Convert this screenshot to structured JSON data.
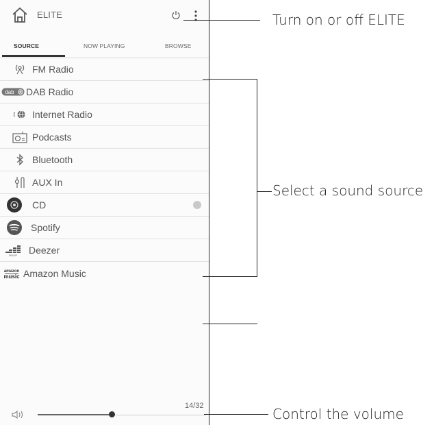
{
  "app": {
    "title": "ELITE"
  },
  "tabs": [
    {
      "label": "SOURCE",
      "active": true
    },
    {
      "label": "NOW PLAYING",
      "active": false
    },
    {
      "label": "BROWSE",
      "active": false
    }
  ],
  "sources": [
    {
      "label": "FM Radio",
      "icon": "fm-radio-icon"
    },
    {
      "label": "DAB Radio",
      "icon": "dab-icon",
      "badge": "dab"
    },
    {
      "label": "Internet Radio",
      "icon": "globe-icon"
    },
    {
      "label": "Podcasts",
      "icon": "podcast-icon"
    },
    {
      "label": "Bluetooth",
      "icon": "bluetooth-icon"
    },
    {
      "label": "AUX In",
      "icon": "aux-icon"
    },
    {
      "label": "CD",
      "icon": "cd-icon"
    },
    {
      "label": "Spotify",
      "icon": "spotify-icon"
    },
    {
      "label": "Deezer",
      "icon": "deezer-icon",
      "badge": "deezer"
    },
    {
      "label": "Amazon Music",
      "icon": "amazon-music-icon",
      "badge": "amazon music"
    }
  ],
  "volume": {
    "readout": "14/32",
    "current": 14,
    "max": 32
  },
  "callouts": {
    "power": "Turn on or off ELITE",
    "source": "Select a sound source",
    "volume": "Control the volume"
  }
}
